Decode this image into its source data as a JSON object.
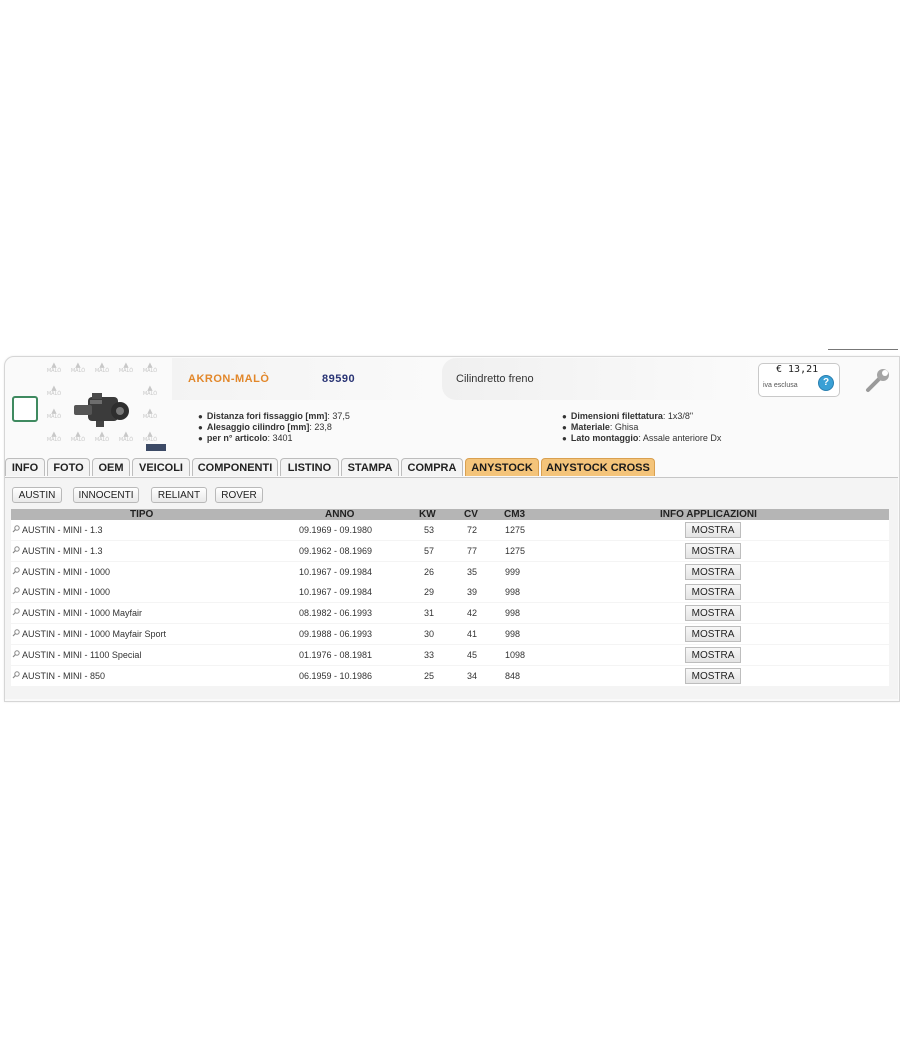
{
  "product": {
    "brand": "AKRON-MALÒ",
    "code": "89590",
    "description": "Cilindretto freno",
    "price": "€ 13,21",
    "vat_note": "iva esclusa",
    "help_label": "?",
    "logo_text": "MALÒ",
    "accent_color": "#e2872a",
    "code_color": "#2a3575"
  },
  "specs_left": [
    {
      "label": "Distanza fori fissaggio [mm]",
      "value": ": 37,5"
    },
    {
      "label": "Alesaggio cilindro [mm]",
      "value": ": 23,8"
    },
    {
      "label": "per n° articolo",
      "value": ": 3401"
    }
  ],
  "specs_right": [
    {
      "label": "Dimensioni filettatura",
      "value": ": 1x3/8\""
    },
    {
      "label": "Materiale",
      "value": ": Ghisa"
    },
    {
      "label": "Lato montaggio",
      "value": ": Assale anteriore Dx"
    }
  ],
  "tabs": [
    {
      "label": "INFO",
      "active": false
    },
    {
      "label": "FOTO",
      "active": false
    },
    {
      "label": "OEM",
      "active": false
    },
    {
      "label": "VEICOLI",
      "active": false
    },
    {
      "label": "COMPONENTI",
      "active": false
    },
    {
      "label": "LISTINO",
      "active": false
    },
    {
      "label": "STAMPA",
      "active": false
    },
    {
      "label": "COMPRA",
      "active": false
    },
    {
      "label": "ANYSTOCK",
      "active": false
    },
    {
      "label": "ANYSTOCK CROSS",
      "active": false
    }
  ],
  "filters": [
    "AUSTIN",
    "INNOCENTI",
    "RELIANT",
    "ROVER"
  ],
  "table": {
    "headers": [
      "TIPO",
      "ANNO",
      "KW",
      "CV",
      "CM3",
      "INFO APPLICAZIONI"
    ],
    "button_label": "MOSTRA",
    "rows": [
      {
        "tipo": "AUSTIN - MINI - 1.3",
        "anno": "09.1969 - 09.1980",
        "kw": "53",
        "cv": "72",
        "cm3": "1275"
      },
      {
        "tipo": "AUSTIN - MINI - 1.3",
        "anno": "09.1962 - 08.1969",
        "kw": "57",
        "cv": "77",
        "cm3": "1275"
      },
      {
        "tipo": "AUSTIN - MINI - 1000",
        "anno": "10.1967 - 09.1984",
        "kw": "26",
        "cv": "35",
        "cm3": "999"
      },
      {
        "tipo": "AUSTIN - MINI - 1000",
        "anno": "10.1967 - 09.1984",
        "kw": "29",
        "cv": "39",
        "cm3": "998"
      },
      {
        "tipo": "AUSTIN - MINI - 1000 Mayfair",
        "anno": "08.1982 - 06.1993",
        "kw": "31",
        "cv": "42",
        "cm3": "998"
      },
      {
        "tipo": "AUSTIN - MINI - 1000 Mayfair Sport",
        "anno": "09.1988 - 06.1993",
        "kw": "30",
        "cv": "41",
        "cm3": "998"
      },
      {
        "tipo": "AUSTIN - MINI - 1100 Special",
        "anno": "01.1976 - 08.1981",
        "kw": "33",
        "cv": "45",
        "cm3": "1098"
      },
      {
        "tipo": "AUSTIN - MINI - 850",
        "anno": "06.1959 - 10.1986",
        "kw": "25",
        "cv": "34",
        "cm3": "848"
      }
    ]
  }
}
